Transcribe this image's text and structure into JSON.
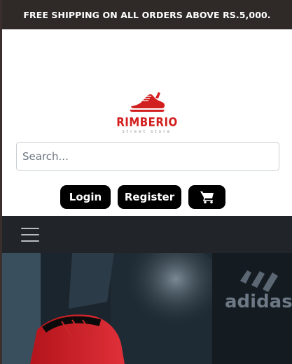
{
  "announcement": "FREE SHIPPING ON ALL ORDERS ABOVE RS.5,000.",
  "brand": {
    "name": "RIMBERIO",
    "tagline": "street store"
  },
  "search": {
    "placeholder": "Search..."
  },
  "actions": {
    "login": "Login",
    "register": "Register",
    "cart_icon": "cart-icon"
  },
  "navbar": {
    "toggle_icon": "hamburger-icon"
  },
  "hero": {
    "brand_text": "adidas"
  },
  "colors": {
    "accent": "#d21f1f",
    "topbar": "#2f2a28",
    "navbar": "#212529",
    "button": "#000000"
  }
}
